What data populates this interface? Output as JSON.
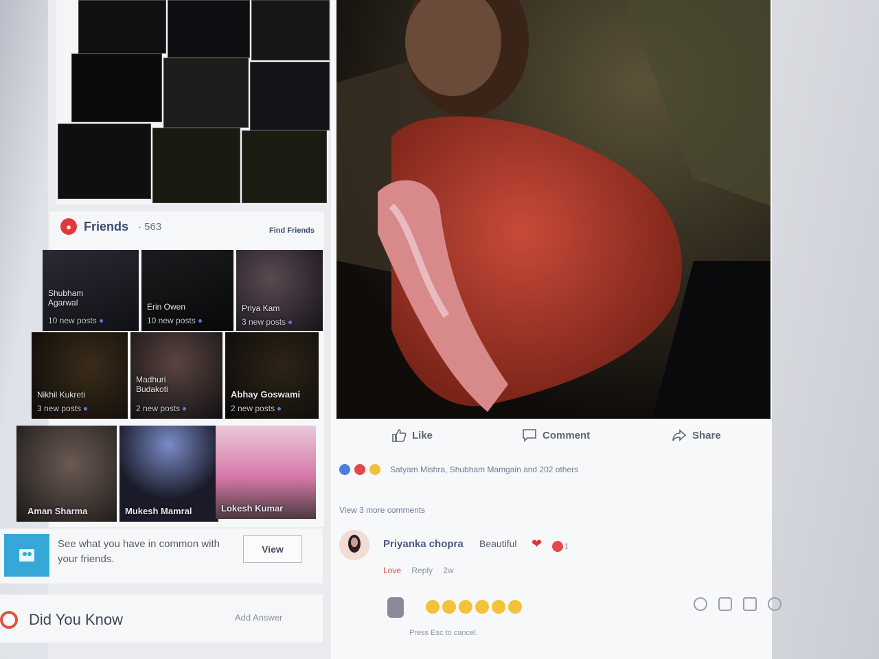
{
  "friends": {
    "title": "Friends",
    "count": "· 563",
    "find_friends": "Find Friends",
    "tiles": [
      {
        "name": "Shubham Agarwal",
        "posts": "10 new posts"
      },
      {
        "name": "Erin Owen",
        "posts": "10 new posts"
      },
      {
        "name": "Priya Kam",
        "posts": "3 new posts"
      },
      {
        "name": "Nikhil Kukreti",
        "posts": "3 new posts"
      },
      {
        "name": "Madhuri Budakoti",
        "posts": "2 new posts"
      },
      {
        "name": "Abhay Goswami",
        "posts": "2 new posts"
      },
      {
        "name": "Aman Sharma",
        "posts": ""
      },
      {
        "name": "Mukesh Mamral",
        "posts": ""
      },
      {
        "name": "Lokesh Kumar",
        "posts": ""
      }
    ]
  },
  "common": {
    "text": "See what you have in common with your friends.",
    "button": "View"
  },
  "did_you_know": {
    "title": "Did You Know",
    "action": "Add Answer"
  },
  "post": {
    "actions": {
      "like": "Like",
      "comment": "Comment",
      "share": "Share"
    },
    "reactions_text": "Satyam Mishra, Shubham Mamgain and 202 others",
    "view_more": "View 3 more comments",
    "comment": {
      "author": "Priyanka chopra",
      "text": "Beautiful",
      "reaction_count": "1",
      "love": "Love",
      "reply": "Reply",
      "time": "2w"
    },
    "escape_hint": "Press Esc to cancel."
  },
  "colors": {
    "accent": "#3b4a6e",
    "love": "#e0353e",
    "blue_link": "#6d7a9c"
  }
}
